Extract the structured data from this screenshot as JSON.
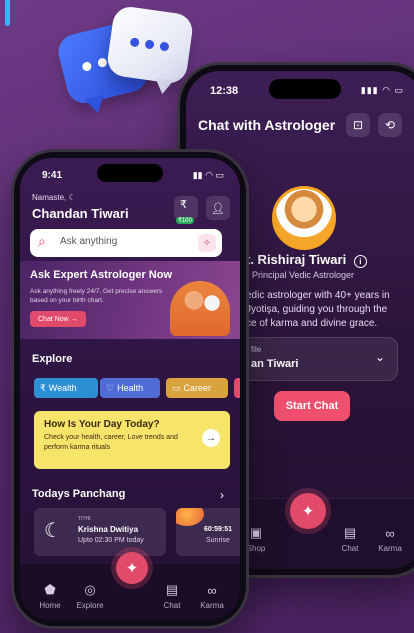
{
  "back_phone": {
    "status_time": "12:38",
    "header_title": "Chat with Astrologer",
    "astrologer": {
      "name": "t. Rishiraj Tiwari",
      "role": "Principal Vedic Astrologer",
      "bio": "edic astrologer with 40+ years in Jyotişa, guiding you through the ce of karma and divine grace."
    },
    "profile": {
      "label": "file",
      "value": "an Tiwari"
    },
    "start_chat_label": "Start Chat",
    "nav": {
      "shop": "Shop",
      "chat": "Chat",
      "karma": "Karma"
    }
  },
  "front_phone": {
    "status_time": "9:41",
    "greeting": "Namaste,",
    "user_name": "Chandan Tiwari",
    "wallet_amount": "₹100",
    "search_placeholder": "Ask anything",
    "banner": {
      "title": "Ask Expert Astrologer Now",
      "subtitle": "Ask anything freely 24/7. Get precise answers based on your birth chart.",
      "cta": "Chat Now →"
    },
    "explore_title": "Explore",
    "chips": {
      "wealth": "Wealth",
      "health": "Health",
      "career": "Career"
    },
    "day_card": {
      "title": "How Is Your Day Today?",
      "text": "Check your health, career, Love trends and perform karma rituals"
    },
    "panchang_title": "Todays Panchang",
    "tithi": {
      "label": "TITHI",
      "name": "Krishna Dwitiya",
      "time": "Upto 02:30 PM today"
    },
    "sunrise": {
      "time": "60:59:51",
      "label": "Sunrise"
    },
    "nav": {
      "home": "Home",
      "explore": "Explore",
      "chat": "Chat",
      "karma": "Karma"
    }
  }
}
